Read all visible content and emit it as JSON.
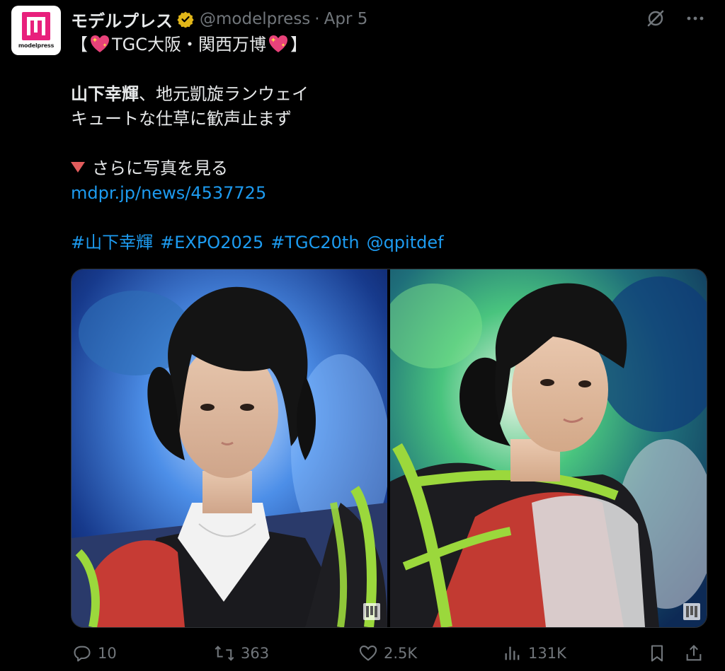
{
  "avatar": {
    "text": "modelpress",
    "brand_color": "#e8207c"
  },
  "author": {
    "display_name": "モデルプレス",
    "handle": "@modelpress",
    "separator": "·",
    "date": "Apr 5",
    "verified_color": "#e2b719"
  },
  "tweet": {
    "headline_open": "【",
    "headline_text": "TGC大阪・関西万博",
    "headline_close": "】",
    "line2_bold": "山下幸輝",
    "line2_rest": "、地元凱旋ランウェイ",
    "line3": "キュートな仕草に歓声止まず",
    "line4": "さらに写真を見る",
    "link": "mdpr.jp/news/4537725",
    "hashtags": [
      "#山下幸輝",
      "#EXPO2025",
      "#TGC20th",
      "@qpitdef"
    ]
  },
  "media": {
    "photo1_watermark": "m",
    "photo2_watermark": "m"
  },
  "actions": {
    "replies": "10",
    "reposts": "363",
    "likes": "2.5K",
    "views": "131K"
  },
  "colors": {
    "background": "#000000",
    "text": "#e7e9ea",
    "muted": "#71767b",
    "link": "#1d9bf0"
  }
}
